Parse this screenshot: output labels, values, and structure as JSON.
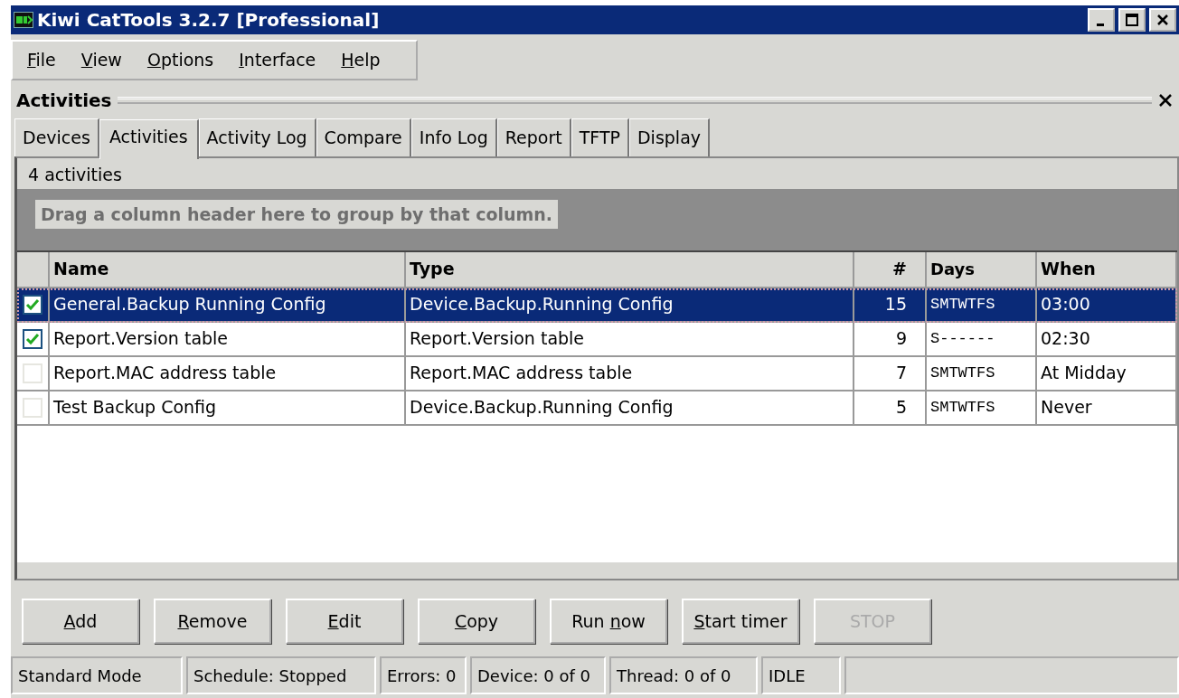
{
  "window": {
    "title": "Kiwi CatTools 3.2.7 [Professional]"
  },
  "menu": [
    {
      "key": "F",
      "post": "ile"
    },
    {
      "key": "V",
      "post": "iew"
    },
    {
      "key": "O",
      "post": "ptions"
    },
    {
      "key": "I",
      "post": "nterface"
    },
    {
      "key": "H",
      "post": "elp"
    }
  ],
  "pane": {
    "title": "Activities"
  },
  "tabs": [
    {
      "label": "Devices",
      "selected": false
    },
    {
      "label": "Activities",
      "selected": true
    },
    {
      "label": "Activity Log",
      "selected": false
    },
    {
      "label": "Compare",
      "selected": false
    },
    {
      "label": "Info Log",
      "selected": false
    },
    {
      "label": "Report",
      "selected": false
    },
    {
      "label": "TFTP",
      "selected": false
    },
    {
      "label": "Display",
      "selected": false
    }
  ],
  "panel_header": "4 activities",
  "group_hint": "Drag a column header here to group by that column.",
  "table": {
    "columns": [
      "Name",
      "Type",
      "#",
      "Days",
      "When"
    ],
    "rows": [
      {
        "checked": true,
        "selected": true,
        "cells": [
          "General.Backup Running Config",
          "Device.Backup.Running Config",
          "15",
          "SMTWTFS",
          "03:00"
        ]
      },
      {
        "checked": true,
        "selected": false,
        "cells": [
          "Report.Version table",
          "Report.Version table",
          "9",
          "S------",
          "02:30"
        ]
      },
      {
        "checked": false,
        "selected": false,
        "cells": [
          "Report.MAC address table",
          "Report.MAC address table",
          "7",
          "SMTWTFS",
          "At Midday"
        ]
      },
      {
        "checked": false,
        "selected": false,
        "cells": [
          "Test Backup Config",
          "Device.Backup.Running Config",
          "5",
          "SMTWTFS",
          "Never"
        ]
      }
    ]
  },
  "buttons": [
    {
      "key": "A",
      "post": "dd",
      "disabled": false
    },
    {
      "key": "R",
      "post": "emove",
      "disabled": false
    },
    {
      "key": "E",
      "post": "dit",
      "disabled": false
    },
    {
      "key": "C",
      "post": "opy",
      "disabled": false
    },
    {
      "pre": "Run ",
      "key": "n",
      "post": "ow",
      "disabled": false
    },
    {
      "key": "S",
      "post": "tart timer",
      "disabled": false
    },
    {
      "pre": "STOP",
      "disabled": true
    }
  ],
  "status_bar": [
    "Standard Mode",
    "Schedule: Stopped",
    "Errors: 0",
    "Device: 0 of 0",
    "Thread: 0 of 0",
    "IDLE"
  ]
}
